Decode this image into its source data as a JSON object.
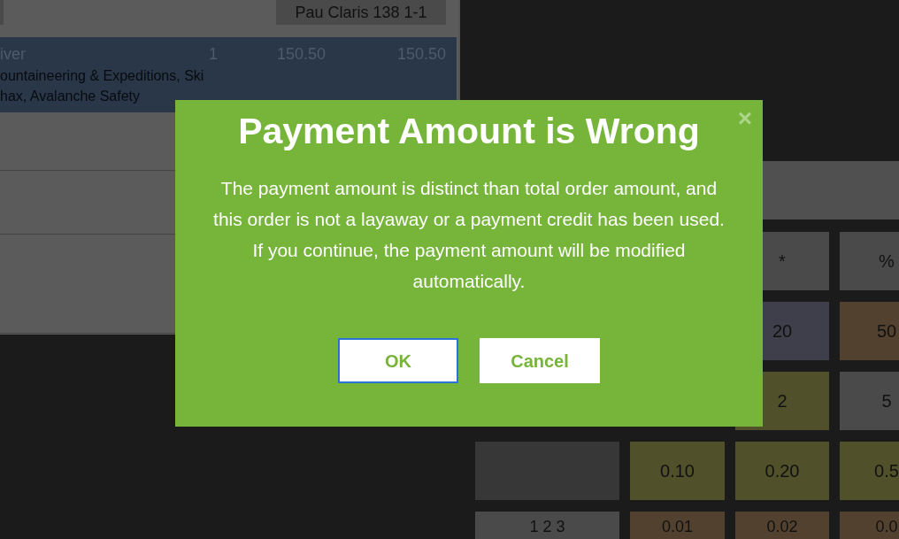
{
  "top_bar": {
    "location_button": "Pau Claris 138 1-1"
  },
  "order_lines": [
    {
      "product": "iver",
      "quantity": "1",
      "price": "150.50",
      "total": "150.50",
      "description": "ountaineering & Expeditions, Ski\nhax, Avalanche Safety",
      "selected": true
    }
  ],
  "keypad": {
    "rows": [
      {
        "keys": [
          {
            "label": "*",
            "kind": "operator"
          },
          {
            "label": "%",
            "kind": "operator"
          }
        ]
      },
      {
        "keys": [
          {
            "label": "20",
            "kind": "note"
          },
          {
            "label": "50",
            "kind": "bill"
          }
        ]
      },
      {
        "keys": [
          {
            "label": "2",
            "kind": "coin"
          },
          {
            "label": "5",
            "kind": "operator"
          }
        ]
      },
      {
        "keys": [
          {
            "kind": "blank"
          },
          {
            "label": "0.10",
            "kind": "coin"
          },
          {
            "label": "0.20",
            "kind": "coin"
          },
          {
            "label": "0.5",
            "kind": "coin"
          }
        ]
      },
      {
        "keys": [
          {
            "label": "1 2 3",
            "kind": "operator"
          },
          {
            "label": "0.01",
            "kind": "bill"
          },
          {
            "label": "0.02",
            "kind": "bill"
          },
          {
            "label": "0.0",
            "kind": "bill"
          }
        ]
      }
    ]
  },
  "dialog": {
    "title": "Payment Amount is Wrong",
    "close": "×",
    "message": "The payment amount is distinct than total order amount, and\nthis order is not a layaway or a payment credit has been used.\nIf you continue, the payment amount will be modified\nautomatically.",
    "buttons": [
      {
        "label": "OK",
        "focused": true
      },
      {
        "label": "Cancel",
        "focused": false
      }
    ]
  }
}
